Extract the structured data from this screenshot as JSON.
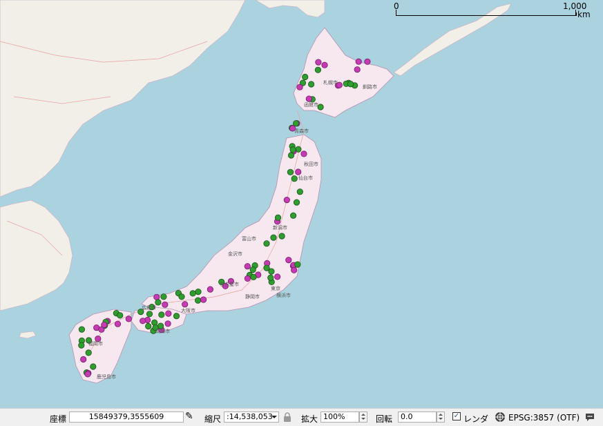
{
  "map": {
    "scale_bar": {
      "start": "0",
      "end": "1,000",
      "unit": "km"
    },
    "colors": {
      "sea": "#aad3df",
      "land": "#f2efe9",
      "japan": "#f6e8ee",
      "green_marker": "#2f9e2f",
      "magenta_marker": "#c63bb4"
    },
    "place_labels": [
      "福岡市",
      "大阪市",
      "名古屋市",
      "東京",
      "札幌市",
      "釧路市",
      "仙台市",
      "新潟市",
      "広島市",
      "鹿児島市",
      "高知市",
      "函館市",
      "青森市",
      "秋田市",
      "静岡市",
      "富山市",
      "金沢市",
      "横浜市"
    ]
  },
  "status": {
    "coord_label": "座標",
    "coord_value": "15849379,3555609",
    "scale_label": "縮尺",
    "scale_value": ":14,538,053",
    "magnify_label": "拡大",
    "magnify_value": "100%",
    "rotation_label": "回転",
    "rotation_value": "0.0",
    "render_label": "レンダ",
    "render_checked": true,
    "crs_label": "EPSG:3857 (OTF)"
  }
}
